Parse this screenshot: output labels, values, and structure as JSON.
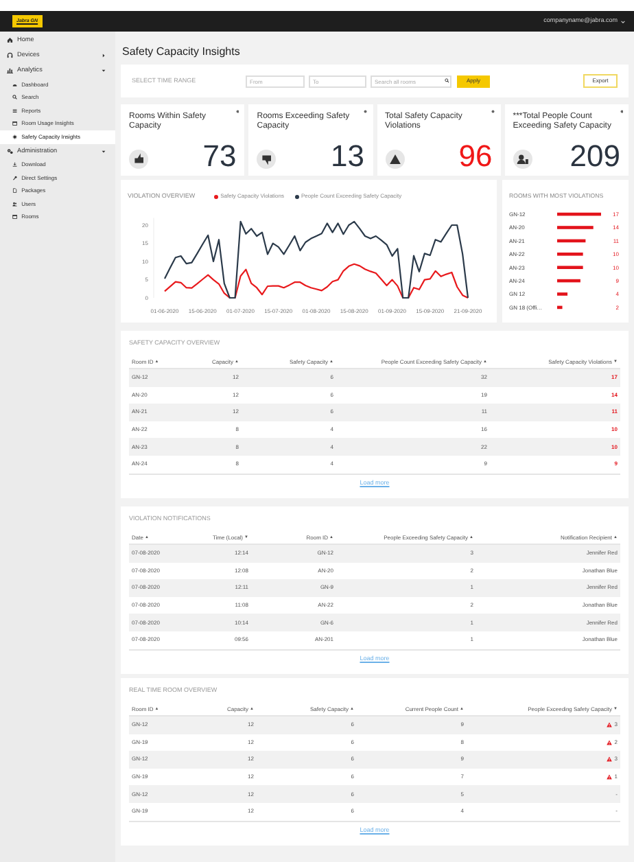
{
  "header": {
    "logo_text": "Jabra GN",
    "user_email": "companyname@jabra.com"
  },
  "sidebar": {
    "items": [
      {
        "label": "Home",
        "selected": false
      },
      {
        "label": "Devices",
        "selected": false,
        "expanded": false
      },
      {
        "label": "Analytics",
        "selected": false,
        "expanded": true,
        "children": [
          {
            "label": "Dashboard",
            "selected": false
          },
          {
            "label": "Search",
            "selected": false
          },
          {
            "label": "Reports",
            "selected": false
          },
          {
            "label": "Room Usage Insights",
            "selected": false
          },
          {
            "label": "Safety Capacity Insights",
            "selected": true
          }
        ]
      },
      {
        "label": "Administration",
        "selected": false,
        "expanded": true,
        "children": [
          {
            "label": "Download",
            "selected": false
          },
          {
            "label": "Direct Settings",
            "selected": false
          },
          {
            "label": "Packages",
            "selected": false
          },
          {
            "label": "Users",
            "selected": false
          },
          {
            "label": "Rooms",
            "selected": false
          }
        ]
      }
    ]
  },
  "page_title": "Safety Capacity Insights",
  "time_range": {
    "label": "SELECT TIME RANGE",
    "from_placeholder": "From",
    "to_placeholder": "To",
    "search_placeholder": "Search all rooms",
    "apply_label": "Apply",
    "export_label": "Export"
  },
  "kpis": [
    {
      "title": "Rooms Within Safety Capacity",
      "value": "73",
      "alert": false
    },
    {
      "title": "Rooms Exceeding Safety Capacity",
      "value": "13",
      "alert": false
    },
    {
      "title": "Total Safety Capacity Violations",
      "value": "96",
      "alert": true
    },
    {
      "title": "***Total People Count Exceeding Safety Capacity",
      "value": "209",
      "alert": false
    }
  ],
  "violation_overview": {
    "chart_data": {
      "type": "line",
      "title": "VIOLATION OVERVIEW",
      "categories": [
        "01-06-2020",
        null,
        null,
        null,
        null,
        null,
        null,
        "15-06-2020",
        null,
        null,
        null,
        null,
        null,
        null,
        "01-07-2020",
        null,
        null,
        null,
        null,
        null,
        null,
        "15-07-2020",
        null,
        null,
        null,
        null,
        null,
        null,
        "01-08-2020",
        null,
        null,
        null,
        null,
        null,
        null,
        "15-08-2020",
        null,
        null,
        null,
        null,
        null,
        null,
        "01-09-2020",
        null,
        null,
        null,
        null,
        null,
        null,
        "15-09-2020",
        null,
        null,
        null,
        null,
        null,
        null,
        "21-09-2020"
      ],
      "series": [
        {
          "name": "Safety Capacity Violations",
          "color": "#e8191c",
          "values": [
            1.8,
            3.1,
            4.4,
            4.2,
            2.8,
            2.7,
            3.9,
            5.1,
            6.3,
            5,
            3.8,
            1.3,
            0,
            0,
            6,
            7.8,
            4,
            2.8,
            0.9,
            3.2,
            3.3,
            3.3,
            2.8,
            3.5,
            4.3,
            4.3,
            3.4,
            2.8,
            2.4,
            2,
            3,
            4.5,
            5,
            7.4,
            8.7,
            9.3,
            8.8,
            7.9,
            7.3,
            6.8,
            5.1,
            3.4,
            5,
            3.3,
            0,
            0,
            2.8,
            2.3,
            5,
            5.2,
            7.4,
            5.9,
            6.5,
            7,
            3,
            0.7,
            0
          ]
        },
        {
          "name": "People Count Exceeding Safety Capacity",
          "color": "#2b3a4a",
          "values": [
            5.3,
            8.2,
            11.1,
            11.5,
            9.4,
            9.7,
            12.2,
            14.7,
            17.2,
            10,
            16,
            4,
            0,
            0,
            21,
            17.6,
            19,
            17,
            18,
            12,
            15,
            14,
            12,
            14.5,
            17,
            13,
            15.3,
            16.3,
            17,
            17.7,
            20.5,
            18,
            20.5,
            17.5,
            20,
            21,
            19,
            17,
            16.3,
            17,
            15.8,
            14.6,
            11.5,
            13.5,
            0,
            0,
            11.6,
            7.2,
            12.2,
            11.7,
            16,
            15.4,
            17.7,
            20,
            20,
            12,
            0
          ]
        }
      ],
      "ylim": [
        0,
        22
      ],
      "yticks": [
        0,
        5,
        10,
        15,
        20
      ]
    }
  },
  "rooms_with_most_violations": {
    "chart_data": {
      "type": "bar",
      "orientation": "horizontal",
      "title": "ROOMS WITH MOST VIOLATIONS",
      "categories": [
        "GN-12",
        "AN-20",
        "AN-21",
        "AN-22",
        "AN-23",
        "AN-24",
        "GN 12",
        "GN 18 (Offi…"
      ],
      "values": [
        17,
        14,
        11,
        10,
        10,
        9,
        4,
        2
      ],
      "data_labels": true
    }
  },
  "tables": [
    {
      "title": "SAFETY CAPACITY OVERVIEW",
      "columns": [
        {
          "label": "Room ID",
          "sort": "▲",
          "highlight": false
        },
        {
          "label": "Capacity",
          "sort": "▲",
          "highlight": false
        },
        {
          "label": "Safety Capacity",
          "sort": "▲",
          "highlight": false
        },
        {
          "label": "People Count Exceeding Safety Capacity",
          "sort": "▲",
          "highlight": false
        },
        {
          "label": "Safety Capacity Violations",
          "sort": "▼",
          "highlight": true
        }
      ],
      "rows": [
        {
          "cells": [
            "GN-12",
            "12",
            "6",
            "32",
            "17"
          ]
        },
        {
          "cells": [
            "AN-20",
            "12",
            "6",
            "19",
            "14"
          ]
        },
        {
          "cells": [
            "AN-21",
            "12",
            "6",
            "11",
            "11"
          ]
        },
        {
          "cells": [
            "AN-22",
            "8",
            "4",
            "16",
            "10"
          ]
        },
        {
          "cells": [
            "AN-23",
            "8",
            "4",
            "22",
            "10"
          ]
        },
        {
          "cells": [
            "AN-24",
            "8",
            "4",
            "9",
            "9"
          ]
        }
      ],
      "load_more": "Load more"
    },
    {
      "title": "VIOLATION NOTIFICATIONS",
      "columns": [
        {
          "label": "Date",
          "sort": "▲"
        },
        {
          "label": "Time (Local)",
          "sort": "▼"
        },
        {
          "label": "Room ID",
          "sort": "▲"
        },
        {
          "label": "People Exceeding Safety Capacity",
          "sort": "▲"
        },
        {
          "label": "Notification Recipient",
          "sort": "▲"
        }
      ],
      "rows": [
        {
          "cells": [
            "07-08-2020",
            "12:14",
            "GN-12",
            "3",
            "Jennifer Red"
          ]
        },
        {
          "cells": [
            "07-08-2020",
            "12:08",
            "AN-20",
            "2",
            "Jonathan Blue"
          ]
        },
        {
          "cells": [
            "07-08-2020",
            "12:11",
            "GN-9",
            "1",
            "Jennifer Red"
          ]
        },
        {
          "cells": [
            "07-08-2020",
            "11:08",
            "AN-22",
            "2",
            "Jonathan Blue"
          ]
        },
        {
          "cells": [
            "07-08-2020",
            "10:14",
            "GN-6",
            "1",
            "Jennifer Red"
          ]
        },
        {
          "cells": [
            "07-08-2020",
            "09:56",
            "AN-201",
            "1",
            "Jonathan Blue"
          ]
        }
      ],
      "load_more": "Load more"
    },
    {
      "title": "REAL TIME ROOM OVERVIEW",
      "columns": [
        {
          "label": "Room ID",
          "sort": "▲"
        },
        {
          "label": "Capacity",
          "sort": "▲"
        },
        {
          "label": "Safety Capacity",
          "sort": "▲"
        },
        {
          "label": "Current People Count",
          "sort": "▲"
        },
        {
          "label": "People Exceeding Safety Capacity",
          "sort": "▼"
        }
      ],
      "rows": [
        {
          "cells": [
            "GN-12",
            "12",
            "6",
            "9",
            "3"
          ],
          "warning": true
        },
        {
          "cells": [
            "GN-19",
            "12",
            "6",
            "8",
            "2"
          ],
          "warning": true
        },
        {
          "cells": [
            "GN-12",
            "12",
            "6",
            "9",
            "3"
          ],
          "warning": true
        },
        {
          "cells": [
            "GN-19",
            "12",
            "6",
            "7",
            "1"
          ],
          "warning": true
        },
        {
          "cells": [
            "GN-12",
            "12",
            "6",
            "5",
            "-"
          ],
          "warning": false
        },
        {
          "cells": [
            "GN-19",
            "12",
            "6",
            "4",
            "-"
          ],
          "warning": false
        }
      ],
      "load_more": "Load more"
    }
  ]
}
